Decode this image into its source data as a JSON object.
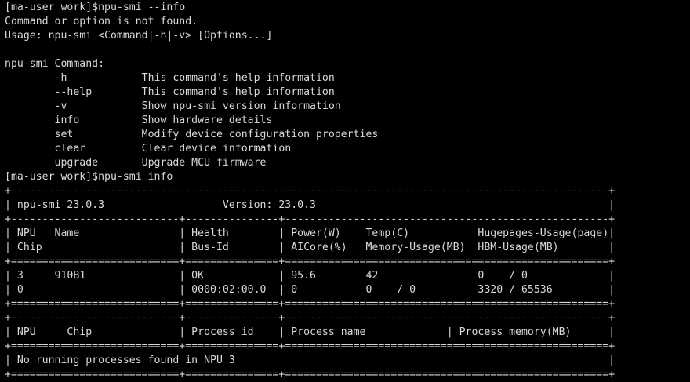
{
  "terminal": {
    "lines": [
      "[ma-user work]$npu-smi --info",
      "Command or option is not found.",
      "Usage: npu-smi <Command|-h|-v> [Options...]",
      "",
      "npu-smi Command:",
      "        -h            This command's help information",
      "        --help        This command's help information",
      "        -v            Show npu-smi version information",
      "        info          Show hardware details",
      "        set           Modify device configuration properties",
      "        clear         Clear device information",
      "        upgrade       Upgrade MCU firmware",
      "[ma-user work]$npu-smi info",
      "+------------------------------------------------------------------------------------------------+",
      "| npu-smi 23.0.3                   Version: 23.0.3                                               |",
      "+---------------------------+---------------+----------------------------------------------------+",
      "| NPU   Name                | Health        | Power(W)    Temp(C)           Hugepages-Usage(page)|",
      "| Chip                      | Bus-Id        | AICore(%)   Memory-Usage(MB)  HBM-Usage(MB)        |",
      "+===========================+===============+====================================================+",
      "| 3     910B1               | OK            | 95.6        42                0    / 0             |",
      "| 0                         | 0000:02:00.0  | 0           0    / 0          3320 / 65536         |",
      "+===========================+===============+====================================================+",
      "+---------------------------+---------------+----------------------------------------------------+",
      "| NPU     Chip              | Process id    | Process name             | Process memory(MB)      |",
      "+===========================+===============+====================================================+",
      "| No running processes found in NPU 3                                                            |",
      "+===========================+===============+====================================================+"
    ]
  }
}
